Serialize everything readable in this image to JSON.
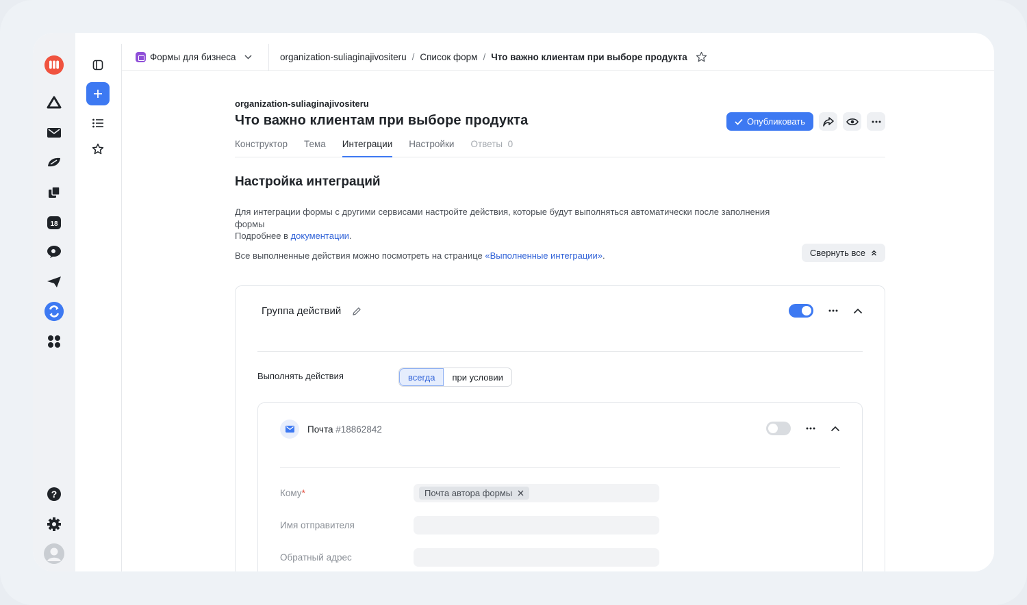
{
  "service": {
    "name": "Формы для бизнеса"
  },
  "breadcrumbs": [
    "organization-suliaginajivositeru",
    "Список форм",
    "Что важно клиентам при выборе продукта"
  ],
  "form": {
    "org": "organization-suliaginajivositeru",
    "title": "Что важно клиентам при выборе продукта",
    "publish_label": "Опубликовать"
  },
  "tabs": [
    {
      "label": "Конструктор"
    },
    {
      "label": "Тема"
    },
    {
      "label": "Интеграции"
    },
    {
      "label": "Настройки"
    },
    {
      "label": "Ответы",
      "count": "0"
    }
  ],
  "section": {
    "title": "Настройка интеграций",
    "desc_line1": "Для интеграции формы с другими сервисами настройте действия, которые будут выполняться автоматически после заполнения формы",
    "desc_more_prefix": "Подробнее в ",
    "desc_more_link": "документации",
    "desc_more_suffix": ".",
    "note_prefix": "Все выполненные действия можно посмотреть на странице ",
    "note_link": "«Выполненные интеграции»",
    "note_suffix": ".",
    "collapse_label": "Свернуть все"
  },
  "group": {
    "title": "Группа действий",
    "enabled": true,
    "run_label": "Выполнять действия",
    "run_options": [
      "всегда",
      "при условии"
    ],
    "run_selected": "всегда"
  },
  "action": {
    "name": "Почта",
    "id": "#18862842",
    "enabled": false,
    "fields": {
      "to_label": "Кому",
      "to_chip": "Почта автора формы",
      "sender_label": "Имя отправителя",
      "reply_label": "Обратный адрес"
    }
  },
  "colors": {
    "accent": "#3d79f2",
    "link": "#3163d8"
  }
}
